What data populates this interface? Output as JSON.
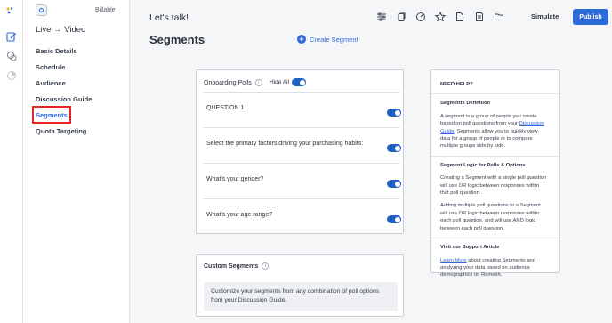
{
  "rail": {
    "icons": [
      "logo-icon",
      "edit-icon",
      "chat-bubbles-icon",
      "pie-chart-icon"
    ]
  },
  "sidebar": {
    "billable_label": "Billable",
    "project_title": "Live → Video",
    "items": [
      {
        "label": "Basic Details"
      },
      {
        "label": "Schedule"
      },
      {
        "label": "Audience"
      },
      {
        "label": "Discussion Guide"
      },
      {
        "label": "Segments"
      },
      {
        "label": "Quota Targeting"
      }
    ]
  },
  "topbar": {
    "title": "Let's talk!",
    "simulate_label": "Simulate",
    "publish_label": "Publish"
  },
  "page": {
    "title": "Segments",
    "create_label": "Create Segment"
  },
  "polls": {
    "header": "Onboarding Polls",
    "hide_all_label": "Hide All",
    "questions": [
      {
        "text": "QUESTION 1"
      },
      {
        "text": "Select the primary factors driving your purchasing habits:"
      },
      {
        "text": "What's your gender?"
      },
      {
        "text": "What's your age range?"
      }
    ]
  },
  "custom": {
    "header": "Custom Segments",
    "description": "Customize your segments from any combination of poll options from your Discussion Guide."
  },
  "help": {
    "title": "NEED HELP?",
    "def_title": "Segments Definition",
    "def_text_1": "A segment is a group of people you create based on poll questions from your ",
    "def_link": "Discussion Guide",
    "def_text_2": ". Segments allow you to quickly view data for a group of people or to compare multiple groups side by side.",
    "logic_title": "Segment Logic for Polls & Options",
    "logic_p1": "Creating a Segment with a single poll question will use OR logic between responses within that poll question.",
    "logic_p2": "Adding multiple poll questions to a Segment will use OR logic between responses within each poll question, and will use AND logic between each poll question.",
    "support_title": "Visit our Support Article",
    "support_link": "Learn More",
    "support_text": " about creating Segments and analyzing your data based on audience demographics on Remesh."
  },
  "colors": {
    "accent": "#2e6ad8",
    "toggle_on": "#1f5fc6",
    "highlight": "#e32626"
  }
}
